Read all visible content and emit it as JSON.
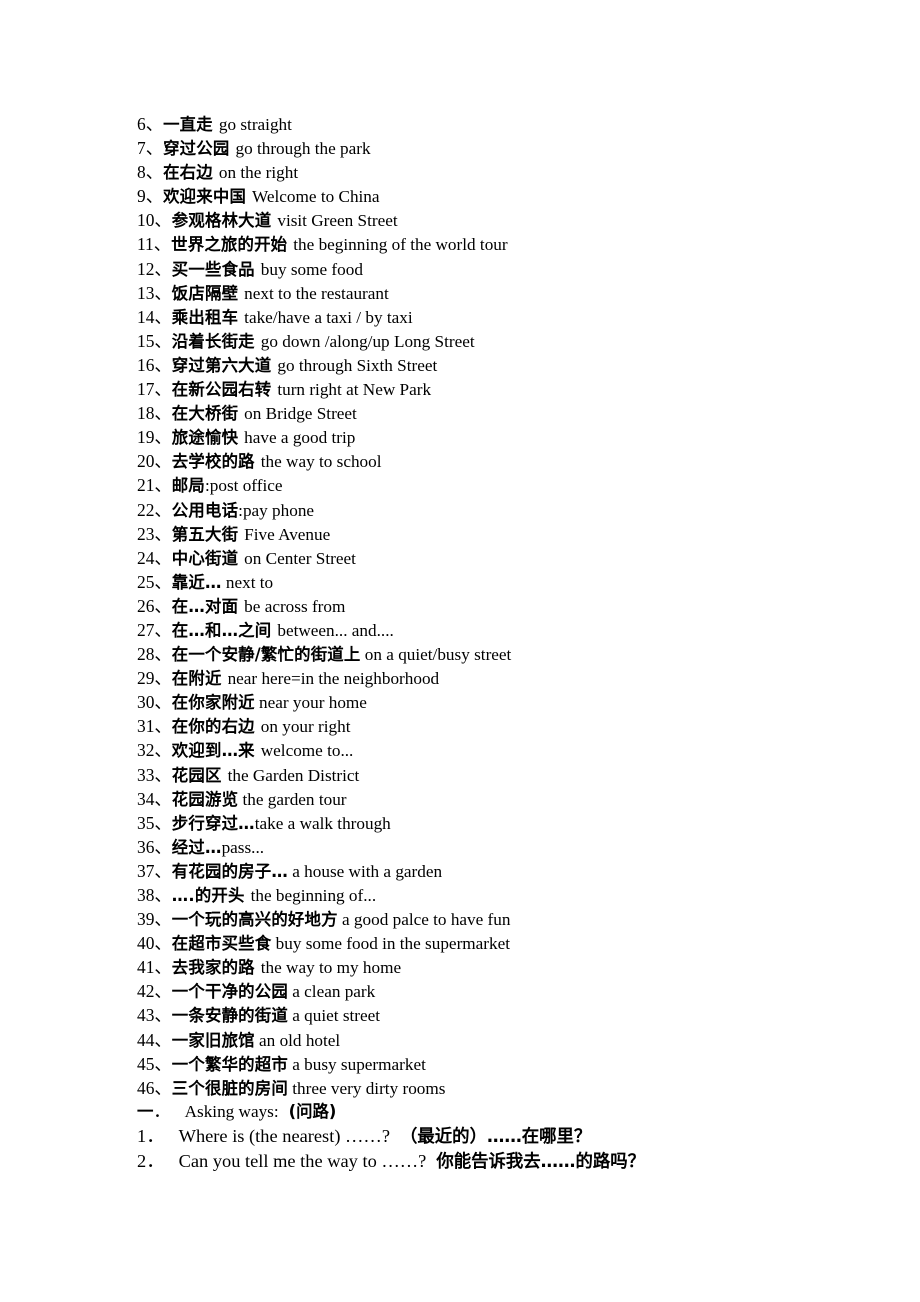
{
  "document": {
    "background_color": "#ffffff",
    "text_color": "#000000"
  },
  "vocab_list": [
    {
      "num": "6、",
      "cn": "一直走",
      "gap": "wide",
      "en": "go straight"
    },
    {
      "num": "7、",
      "cn": "穿过公园",
      "gap": "wide",
      "en": "go through the park"
    },
    {
      "num": "8、",
      "cn": "在右边",
      "gap": "wide",
      "en": "on the right"
    },
    {
      "num": "9、",
      "cn": "欢迎来中国",
      "gap": "wide",
      "en": "Welcome to China"
    },
    {
      "num": "10、",
      "cn": "参观格林大道",
      "gap": "wide",
      "en": "visit Green Street"
    },
    {
      "num": "11、",
      "cn": "世界之旅的开始",
      "gap": "wide",
      "en": "the beginning of the world tour"
    },
    {
      "num": "12、",
      "cn": "买一些食品",
      "gap": "wide",
      "en": "buy some food"
    },
    {
      "num": "13、",
      "cn": "饭店隔壁",
      "gap": "wide",
      "en": "next to the restaurant"
    },
    {
      "num": "14、",
      "cn": "乘出租车",
      "gap": "wide",
      "en": "take/have a taxi / by taxi"
    },
    {
      "num": "15、",
      "cn": "沿着长街走",
      "gap": "wide",
      "en": "go down /along/up Long Street"
    },
    {
      "num": "16、",
      "cn": "穿过第六大道",
      "gap": "wide",
      "en": "go through Sixth Street"
    },
    {
      "num": "17、",
      "cn": "在新公园右转",
      "gap": "wide",
      "en": "turn right at New Park"
    },
    {
      "num": "18、",
      "cn": "在大桥街",
      "gap": "wide",
      "en": "on Bridge Street"
    },
    {
      "num": "19、",
      "cn": "旅途愉快",
      "gap": "wide",
      "en": "have a good trip"
    },
    {
      "num": "20、",
      "cn": "去学校的路",
      "gap": "wide",
      "en": "the way to school"
    },
    {
      "num": "21、",
      "cn": "邮局",
      "gap": "none",
      "en": ":post office"
    },
    {
      "num": "22、",
      "cn": "公用电话",
      "gap": "none",
      "en": ":pay phone"
    },
    {
      "num": "23、",
      "cn": "第五大街",
      "gap": "wide",
      "en": "Five Avenue"
    },
    {
      "num": "24、",
      "cn": "中心街道",
      "gap": "wide",
      "en": "on Center Street"
    },
    {
      "num": "25、",
      "cn": "靠近…",
      "gap": "none",
      "en": " next to"
    },
    {
      "num": "26、",
      "cn": "在…对面",
      "gap": "wide",
      "en": "be across from"
    },
    {
      "num": "27、",
      "cn": "在…和…之间",
      "gap": "wide",
      "en": "between... and...."
    },
    {
      "num": "28、",
      "cn": "在一个安静/繁忙的街道上",
      "gap": "none",
      "en": " on a quiet/busy street"
    },
    {
      "num": "29、",
      "cn": "在附近",
      "gap": "wide",
      "en": "near here=in the neighborhood"
    },
    {
      "num": "30、",
      "cn": "在你家附近",
      "gap": "none",
      "en": " near your home"
    },
    {
      "num": "31、",
      "cn": "在你的右边",
      "gap": "wide",
      "en": "on your right"
    },
    {
      "num": "32、",
      "cn": "欢迎到…来",
      "gap": "wide",
      "en": "welcome to..."
    },
    {
      "num": "33、",
      "cn": "花园区",
      "gap": "wide",
      "en": "the Garden District"
    },
    {
      "num": "34、",
      "cn": "花园游览",
      "gap": "none",
      "en": " the garden tour"
    },
    {
      "num": "35、",
      "cn": "步行穿过…",
      "gap": "none",
      "en": "take a walk through"
    },
    {
      "num": "36、",
      "cn": "经过…",
      "gap": "none",
      "en": "pass..."
    },
    {
      "num": "37、",
      "cn": "有花园的房子…",
      "gap": "none",
      "en": " a house with a garden"
    },
    {
      "num": "38、",
      "cn": "….的开头",
      "gap": "wide",
      "en": "the beginning of..."
    },
    {
      "num": "39、",
      "cn": "一个玩的高兴的好地方",
      "gap": "none",
      "en": " a good palce to have fun"
    },
    {
      "num": "40、",
      "cn": "在超市买些食",
      "gap": "none",
      "en": " buy some food in the supermarket"
    },
    {
      "num": "41、",
      "cn": "去我家的路",
      "gap": "wide",
      "en": "the way to my home"
    },
    {
      "num": "42、",
      "cn": "一个干净的公园",
      "gap": "none",
      "en": " a clean park"
    },
    {
      "num": "43、",
      "cn": "一条安静的街道",
      "gap": "none",
      "en": " a quiet street"
    },
    {
      "num": "44、",
      "cn": "一家旧旅馆",
      "gap": "none",
      "en": " an old hotel"
    },
    {
      "num": "45、",
      "cn": "一个繁华的超市",
      "gap": "none",
      "en": " a busy supermarket"
    },
    {
      "num": "46、",
      "cn": "三个很脏的房间",
      "gap": "none",
      "en": " three very dirty rooms"
    }
  ],
  "section": {
    "marker": "一",
    "marker_dot": "．",
    "title_en": "Asking ways:",
    "title_cn": "(问路)",
    "questions": [
      {
        "num": "1．",
        "en": "Where is (the nearest) ……?",
        "cn": "（最近的）……在哪里？"
      },
      {
        "num": "2．",
        "en": "Can you tell me the way to ……?",
        "cn": "你能告诉我去……的路吗？"
      }
    ]
  }
}
